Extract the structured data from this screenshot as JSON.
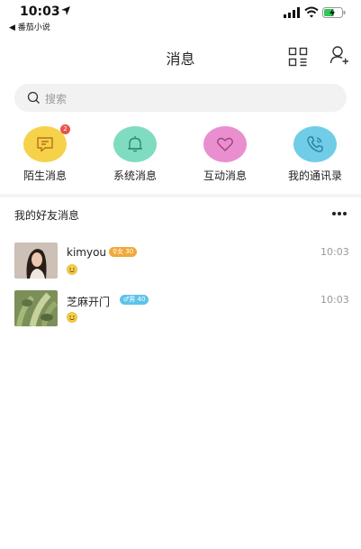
{
  "status_bar": {
    "time": "10:03",
    "back_app": "◀ 番茄小说"
  },
  "nav": {
    "title": "消息"
  },
  "search": {
    "placeholder": "搜索"
  },
  "categories": [
    {
      "label": "陌生消息",
      "badge": "2",
      "color": "#f5d24a",
      "icon": "chat-bubble-icon"
    },
    {
      "label": "系统消息",
      "badge": "",
      "color": "#7fdcc0",
      "icon": "bell-icon"
    },
    {
      "label": "互动消息",
      "badge": "",
      "color": "#e98fcf",
      "icon": "heart-icon"
    },
    {
      "label": "我的通讯录",
      "badge": "",
      "color": "#6fcde8",
      "icon": "phone-icon"
    }
  ],
  "section": {
    "title": "我的好友消息"
  },
  "messages": [
    {
      "name": "kimyou",
      "tag": "♀女 30",
      "tag_color": "#f0a93b",
      "time": "10:03",
      "preview_icon": "smile-emoji-icon"
    },
    {
      "name": "芝麻开门",
      "tag": "♂男 40",
      "tag_color": "#5ec3ea",
      "time": "10:03",
      "preview_icon": "smile-emoji-icon"
    }
  ]
}
